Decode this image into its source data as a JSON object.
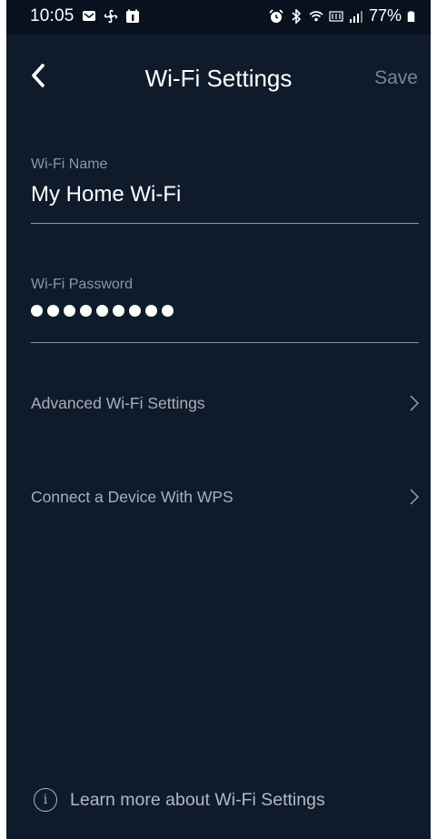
{
  "status_bar": {
    "time": "10:05",
    "battery": "77%"
  },
  "header": {
    "title": "Wi-Fi Settings",
    "save_label": "Save"
  },
  "fields": {
    "name": {
      "label": "Wi-Fi Name",
      "value": "My Home Wi-Fi"
    },
    "password": {
      "label": "Wi-Fi Password",
      "masked_length": 9
    }
  },
  "menu": [
    {
      "label": "Advanced Wi-Fi Settings",
      "icon": "chevron-right-icon"
    },
    {
      "label": "Connect a Device With WPS",
      "icon": "chevron-right-icon"
    }
  ],
  "footer": {
    "text": "Learn more about Wi-Fi Settings",
    "icon": "info-icon"
  },
  "colors": {
    "background": "#0f1b2b",
    "status_bar": "#08111d",
    "text": "#ffffff",
    "muted": "#8d95a1"
  }
}
